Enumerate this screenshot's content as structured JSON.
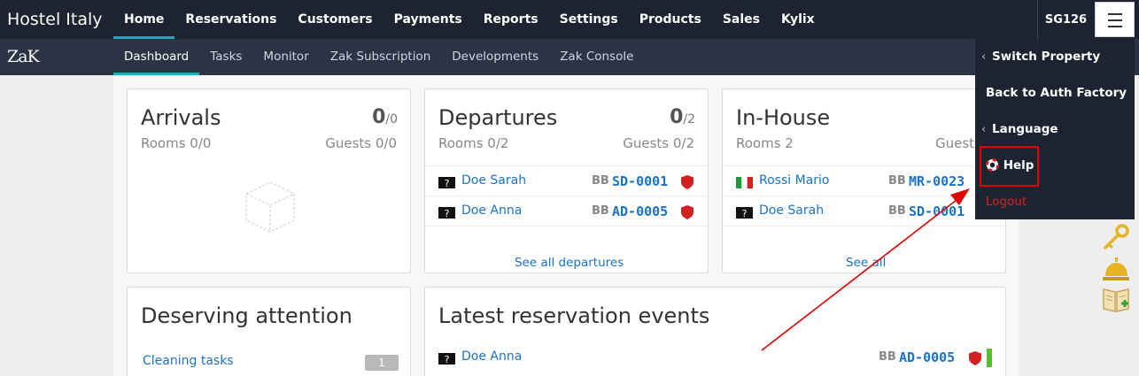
{
  "header": {
    "brand": "Hostel Italy",
    "nav": [
      {
        "label": "Home",
        "active": true
      },
      {
        "label": "Reservations"
      },
      {
        "label": "Customers"
      },
      {
        "label": "Payments"
      },
      {
        "label": "Reports"
      },
      {
        "label": "Settings"
      },
      {
        "label": "Products"
      },
      {
        "label": "Sales"
      },
      {
        "label": "Kylix"
      }
    ],
    "user": "SG126",
    "menu_icon": "hamburger-icon"
  },
  "subheader": {
    "logo": "ZaK",
    "nav": [
      {
        "label": "Dashboard",
        "active": true
      },
      {
        "label": "Tasks"
      },
      {
        "label": "Monitor"
      },
      {
        "label": "Zak Subscription"
      },
      {
        "label": "Developments"
      },
      {
        "label": "Zak Console"
      }
    ]
  },
  "arrivals": {
    "title": "Arrivals",
    "count": "0",
    "total": "/0",
    "rooms": "Rooms 0/0",
    "guests": "Guests 0/0",
    "empty_icon": "empty-box-icon"
  },
  "departures": {
    "title": "Departures",
    "count": "0",
    "total": "/2",
    "rooms": "Rooms 0/2",
    "guests": "Guests 0/2",
    "rows": [
      {
        "name": "Doe Sarah",
        "plan": "BB",
        "code": "SD-0001",
        "flag": "unknown-flag-icon"
      },
      {
        "name": "Doe Anna",
        "plan": "BB",
        "code": "AD-0005",
        "flag": "unknown-flag-icon"
      }
    ],
    "see_all": "See all departures"
  },
  "inhouse": {
    "title": "In-House",
    "rooms": "Rooms 2",
    "guests": "Guest",
    "rows": [
      {
        "name": "Rossi Mario",
        "plan": "BB",
        "code": "MR-0023",
        "flag": "italy-flag-icon"
      },
      {
        "name": "Doe Sarah",
        "plan": "BB",
        "code": "SD-0001",
        "flag": "unknown-flag-icon"
      }
    ],
    "see_all": "See all"
  },
  "attention": {
    "title": "Deserving attention",
    "items": [
      {
        "label": "Cleaning tasks",
        "count": "1"
      }
    ]
  },
  "events": {
    "title": "Latest reservation events",
    "rows": [
      {
        "name": "Doe Anna",
        "plan": "BB",
        "code": "AD-0005",
        "flag": "unknown-flag-icon"
      }
    ]
  },
  "dropdown": {
    "items": [
      {
        "label": "Switch Property",
        "chevron": true
      },
      {
        "label": "Back to Auth Factory"
      },
      {
        "label": "Language",
        "chevron": true
      },
      {
        "label": "Help",
        "icon": "lifebuoy-icon"
      },
      {
        "label": "Logout"
      }
    ]
  },
  "colors": {
    "topbar": "#1d2330",
    "subbar": "#2b3445",
    "accent": "#2aa6b8",
    "link": "#1a73c9",
    "logout": "#e02020",
    "annotation": "#e00000"
  }
}
